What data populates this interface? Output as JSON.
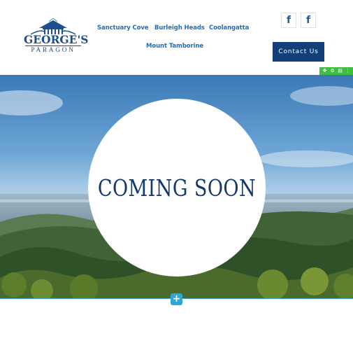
{
  "brand": {
    "name": "GEORGE'S",
    "subname": "PARAGON"
  },
  "nav": {
    "items": [
      {
        "label": "Sanctuary Cove"
      },
      {
        "label": "Burleigh Heads"
      },
      {
        "label": "Coolangatta"
      },
      {
        "label": "Mount Tamborine"
      }
    ]
  },
  "social": {
    "icons": [
      "facebook-icon",
      "facebook-icon"
    ],
    "glyph": "f"
  },
  "contact": {
    "label": "Contact Us"
  },
  "toolbar": {
    "icons": [
      "move-icon",
      "settings-icon",
      "delete-icon",
      "more-icon"
    ]
  },
  "hero": {
    "heading": "COMING SOON"
  },
  "colors": {
    "nav_text": "#1d6ec0",
    "brand_blue": "#1c4f8e",
    "button_bg": "#123f78",
    "toolbar_green": "#3fbf3f",
    "add_button": "#2aa9d8",
    "heading": "#14396d"
  }
}
